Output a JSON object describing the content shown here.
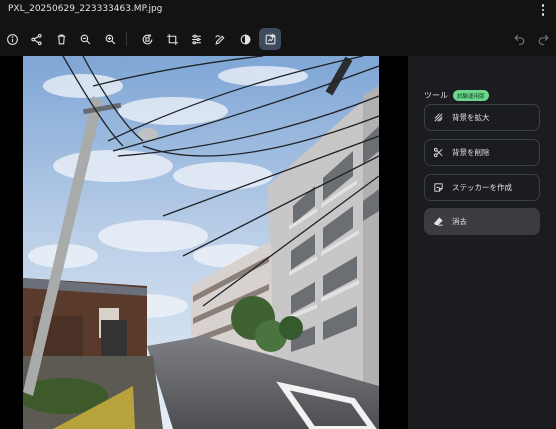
{
  "window": {
    "file_name": "PXL_20250629_223333463.MP.jpg",
    "menu_icon": "more-vert-icon"
  },
  "toolbar": {
    "left": [
      {
        "name": "info-icon"
      },
      {
        "name": "share-icon"
      },
      {
        "name": "delete-icon"
      },
      {
        "name": "zoom-out-icon"
      },
      {
        "name": "zoom-in-icon"
      },
      {
        "name": "rotate-icon"
      },
      {
        "name": "crop-icon"
      },
      {
        "name": "adjust-icon"
      },
      {
        "name": "markup-icon"
      },
      {
        "name": "filter-icon"
      },
      {
        "name": "edit-tools-icon",
        "active": true
      }
    ],
    "right": [
      {
        "name": "undo-icon"
      },
      {
        "name": "redo-icon"
      }
    ]
  },
  "panel": {
    "title": "ツール",
    "badge": "試験運用版",
    "tools": [
      {
        "icon": "expand-background-icon",
        "label": "背景を拡大"
      },
      {
        "icon": "cut-background-icon",
        "label": "背景を削除"
      },
      {
        "icon": "sticker-icon",
        "label": "ステッカーを作成"
      },
      {
        "icon": "eraser-icon",
        "label": "消去",
        "selected": true
      }
    ]
  },
  "photo": {
    "description": "street-photo"
  },
  "colors": {
    "background": "#131314",
    "panel": "#1b1c1f",
    "active": "#3d4b5c",
    "badge": "#6dd58c"
  }
}
